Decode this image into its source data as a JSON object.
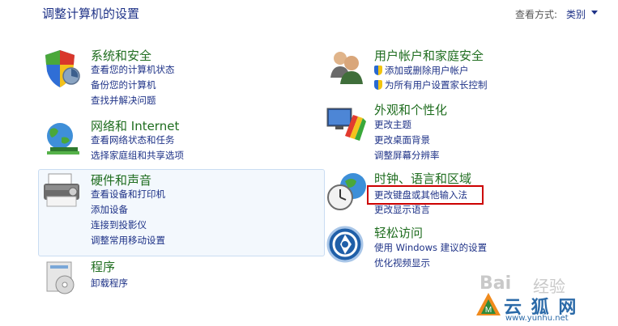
{
  "header": {
    "title": "调整计算机的设置",
    "view_by_label": "查看方式:",
    "view_by_value": "类别"
  },
  "categories": [
    {
      "title": "系统和安全",
      "links": [
        "查看您的计算机状态",
        "备份您的计算机",
        "查找并解决问题"
      ]
    },
    {
      "title": "网络和 Internet",
      "links": [
        "查看网络状态和任务",
        "选择家庭组和共享选项"
      ]
    },
    {
      "title": "硬件和声音",
      "links": [
        "查看设备和打印机",
        "添加设备",
        "连接到投影仪",
        "调整常用移动设置"
      ]
    },
    {
      "title": "程序",
      "links": [
        "卸载程序"
      ]
    },
    {
      "title": "用户帐户和家庭安全",
      "links": [
        "添加或删除用户帐户",
        "为所有用户设置家长控制"
      ]
    },
    {
      "title": "外观和个性化",
      "links": [
        "更改主题",
        "更改桌面背景",
        "调整屏幕分辨率"
      ]
    },
    {
      "title": "时钟、语言和区域",
      "links": [
        "更改键盘或其他输入法",
        "更改显示语言"
      ]
    },
    {
      "title": "轻松访问",
      "links": [
        "使用 Windows 建议的设置",
        "优化视频显示"
      ]
    }
  ],
  "watermark": {
    "baidu": "Bai",
    "jingyan": "经验",
    "site_cn": "云 狐 网",
    "site_url": "www.yunhu.net"
  },
  "colors": {
    "category_title": "#1f6d1f",
    "link": "#1e3287",
    "highlight_box": "#cc0000",
    "hover_panel": "#f3f8fd"
  }
}
